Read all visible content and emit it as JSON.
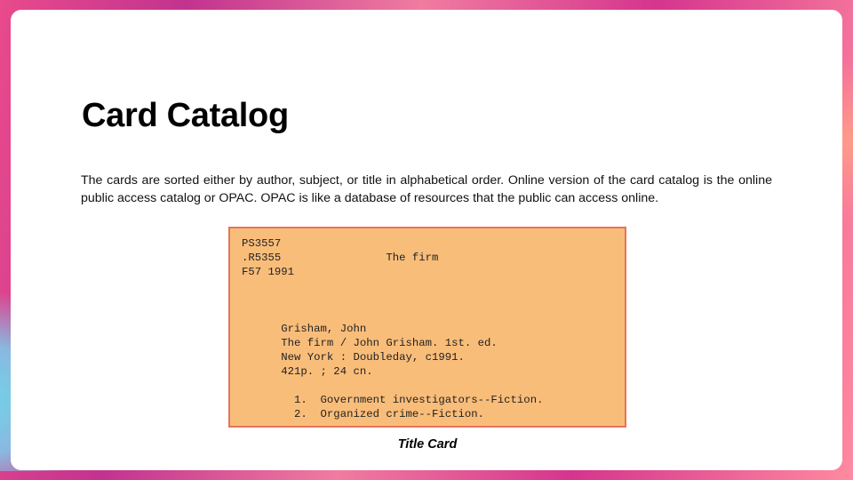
{
  "slide": {
    "title": "Card Catalog",
    "body": "The cards are sorted either by author, subject, or title in alphabetical order. Online version of the card catalog is the online public access catalog or OPAC. OPAC is like a database of resources that the public can access online.",
    "card": {
      "lines": [
        "PS3557",
        ".R5355                The firm",
        "F57 1991",
        "",
        "",
        "",
        "      Grisham, John",
        "      The firm / John Grisham. 1st. ed.",
        "      New York : Doubleday, c1991.",
        "      421p. ; 24 cn.",
        "",
        "        1.  Government investigators--Fiction.",
        "        2.  Organized crime--Fiction."
      ]
    },
    "caption": "Title Card"
  }
}
